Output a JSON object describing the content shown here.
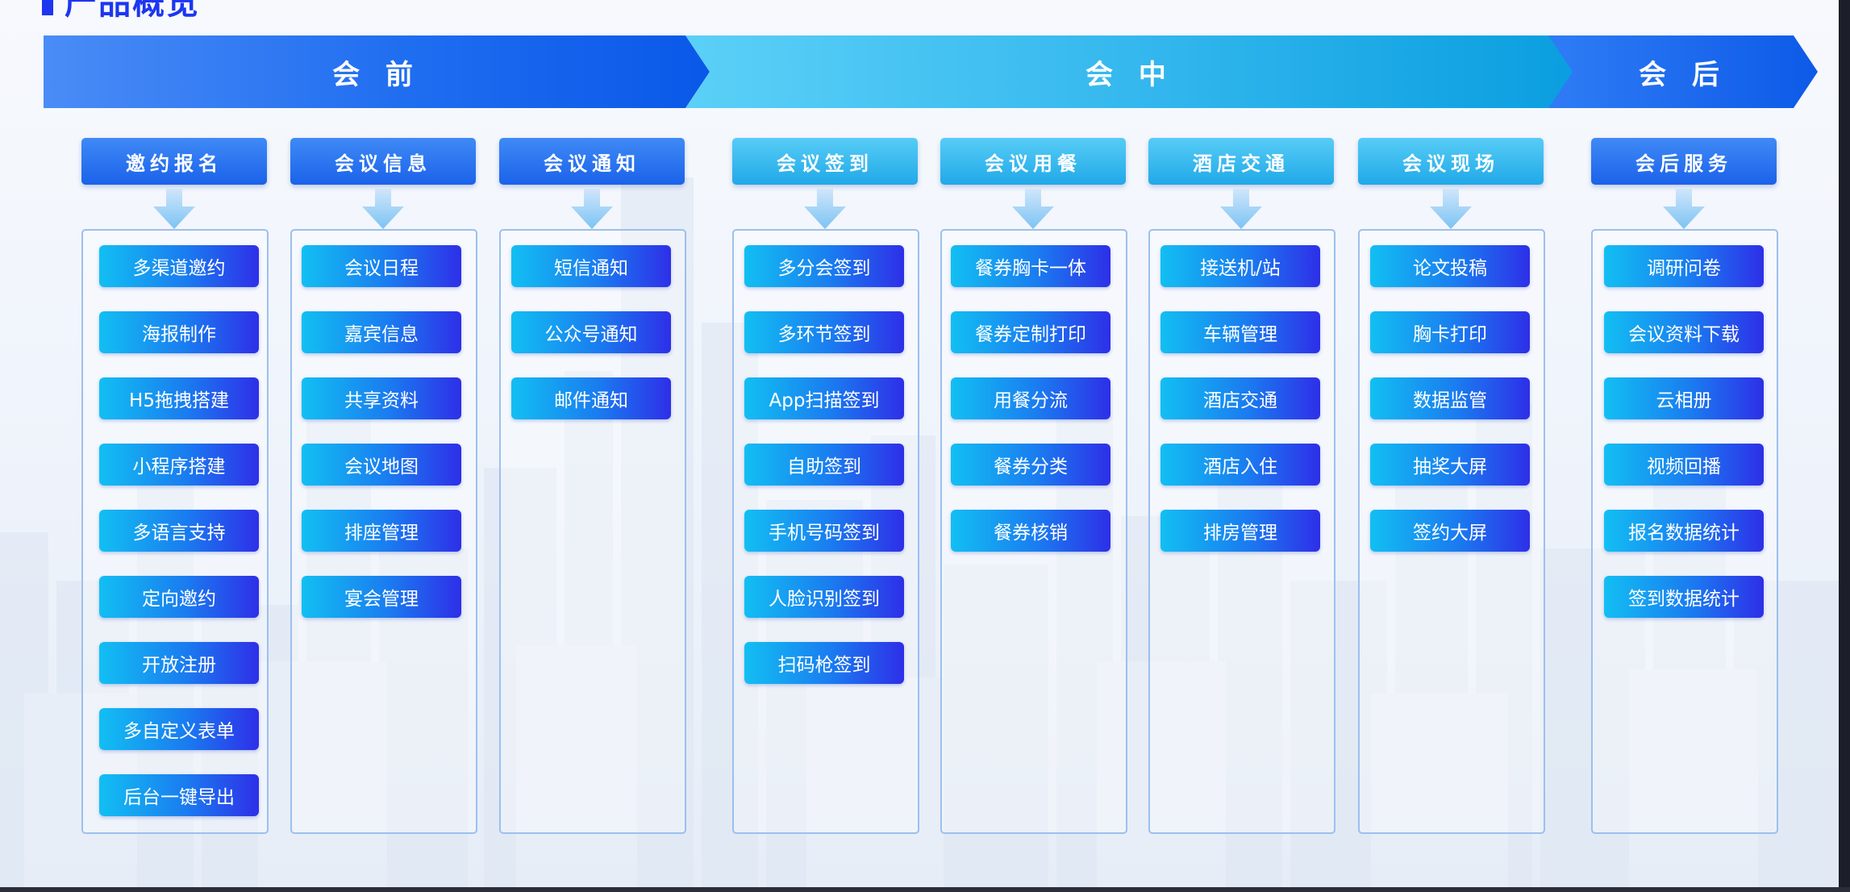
{
  "page_title": "产品概览",
  "phases": [
    {
      "label": "会 前"
    },
    {
      "label": "会 中"
    },
    {
      "label": "会 后"
    }
  ],
  "columns": [
    {
      "title": "邀约报名",
      "style": "blue",
      "items": [
        "多渠道邀约",
        "海报制作",
        "H5拖拽搭建",
        "小程序搭建",
        "多语言支持",
        "定向邀约",
        "开放注册",
        "多自定义表单",
        "后台一键导出"
      ]
    },
    {
      "title": "会议信息",
      "style": "blue",
      "items": [
        "会议日程",
        "嘉宾信息",
        "共享资料",
        "会议地图",
        "排座管理",
        "宴会管理"
      ]
    },
    {
      "title": "会议通知",
      "style": "blue",
      "items": [
        "短信通知",
        "公众号通知",
        "邮件通知"
      ]
    },
    {
      "title": "会议签到",
      "style": "cyan",
      "items": [
        "多分会签到",
        "多环节签到",
        "App扫描签到",
        "自助签到",
        "手机号码签到",
        "人脸识别签到",
        "扫码枪签到"
      ]
    },
    {
      "title": "会议用餐",
      "style": "cyan",
      "items": [
        "餐券胸卡一体",
        "餐券定制打印",
        "用餐分流",
        "餐券分类",
        "餐券核销"
      ]
    },
    {
      "title": "酒店交通",
      "style": "cyan",
      "items": [
        "接送机/站",
        "车辆管理",
        "酒店交通",
        "酒店入住",
        "排房管理"
      ]
    },
    {
      "title": "会议现场",
      "style": "cyan",
      "items": [
        "论文投稿",
        "胸卡打印",
        "数据监管",
        "抽奖大屏",
        "签约大屏"
      ]
    },
    {
      "title": "会后服务",
      "style": "blue",
      "items": [
        "调研问卷",
        "会议资料下载",
        "云相册",
        "视频回播",
        "报名数据统计",
        "签到数据统计"
      ]
    }
  ],
  "colors": {
    "title": "#1d36f0",
    "phase_pre": "#1f6df0",
    "phase_mid": "#35b8ee",
    "phase_post": "#0d5ae8",
    "item_gradient_start": "#12bff2",
    "item_gradient_end": "#2e2fe8",
    "box_border": "#9cc0ee"
  }
}
